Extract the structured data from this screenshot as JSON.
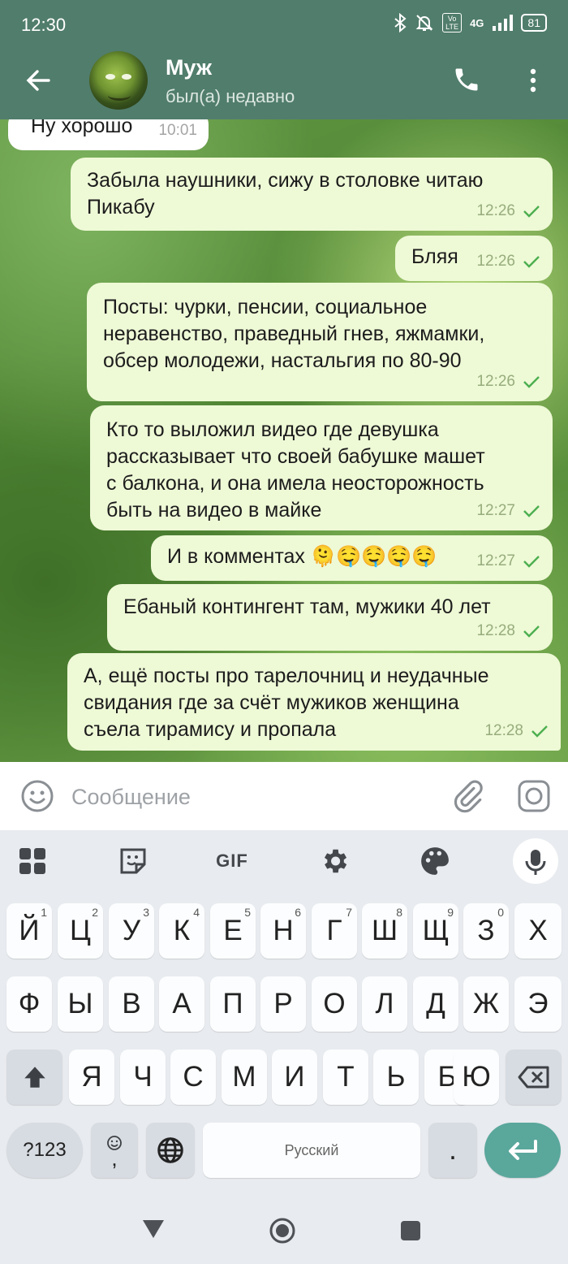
{
  "status_bar": {
    "time": "12:30",
    "network": "4G",
    "volte": "Vo LTE",
    "battery": "81"
  },
  "header": {
    "contact_name": "Муж",
    "last_seen": "был(а) недавно"
  },
  "messages": [
    {
      "direction": "in",
      "text": "Ну хорошо",
      "time": "10:01"
    },
    {
      "direction": "out",
      "text": "Забыла наушники, сижу в столовке читаю\nПикабу",
      "time": "12:26",
      "status": "read"
    },
    {
      "direction": "out",
      "text": "Бляя",
      "time": "12:26",
      "status": "read"
    },
    {
      "direction": "out",
      "text": "Посты: чурки, пенсии, социальное\nнеравенство, праведный гнев, яжмамки,\nобсер молодежи, настальгия по 80-90",
      "time": "12:26",
      "status": "read"
    },
    {
      "direction": "out",
      "text": "Кто то выложил видео где девушка\nрассказывает что своей бабушке машет\nс балкона, и она имела неосторожность\nбыть на видео в майке",
      "time": "12:27",
      "status": "read"
    },
    {
      "direction": "out",
      "text": "И в комментах 🫠🤤🤤🤤🤤",
      "time": "12:27",
      "status": "read"
    },
    {
      "direction": "out",
      "text": "Ебаный контингент там, мужики 40 лет",
      "time": "12:28",
      "status": "read"
    },
    {
      "direction": "out",
      "text": "А, ещё посты про тарелочниц и неудачные\nсвидания где за счёт мужиков женщина\nсъела тирамису и пропала",
      "time": "12:28",
      "status": "read"
    }
  ],
  "composer": {
    "placeholder": "Сообщение"
  },
  "keyboard": {
    "toolbar": {
      "gif_label": "GIF"
    },
    "row1": [
      {
        "label": "Й",
        "hint": "1"
      },
      {
        "label": "Ц",
        "hint": "2"
      },
      {
        "label": "У",
        "hint": "3"
      },
      {
        "label": "К",
        "hint": "4"
      },
      {
        "label": "Е",
        "hint": "5"
      },
      {
        "label": "Н",
        "hint": "6"
      },
      {
        "label": "Г",
        "hint": "7"
      },
      {
        "label": "Ш",
        "hint": "8"
      },
      {
        "label": "Щ",
        "hint": "9"
      },
      {
        "label": "З",
        "hint": "0"
      },
      {
        "label": "Х",
        "hint": ""
      }
    ],
    "row2": [
      "Ф",
      "Ы",
      "В",
      "А",
      "П",
      "Р",
      "О",
      "Л",
      "Д",
      "Ж",
      "Э"
    ],
    "row3": [
      "Я",
      "Ч",
      "С",
      "М",
      "И",
      "Т",
      "Ь",
      "Б",
      "Ю"
    ],
    "symbols_label": "?123",
    "comma_label": ",",
    "space_label": "Русский",
    "period_label": "."
  },
  "colors": {
    "header": "#517d6c",
    "outgoing_bubble": "#eef9d6",
    "incoming_bubble": "#ffffff",
    "enter_key": "#5aa79c",
    "read_check": "#4caf50"
  }
}
